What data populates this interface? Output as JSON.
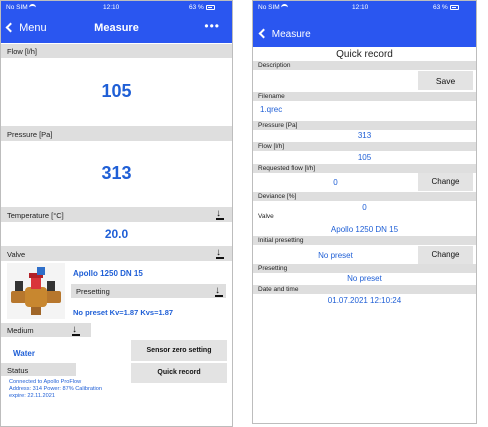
{
  "left": {
    "status": {
      "carrier": "No SIM",
      "time": "12:10",
      "battery": "63 %"
    },
    "nav": {
      "back_label": "Menu",
      "title": "Measure",
      "more": "•••"
    },
    "flow": {
      "label": "Flow [l/h]",
      "value": "105"
    },
    "pressure": {
      "label": "Pressure [Pa]",
      "value": "313"
    },
    "temperature": {
      "label": "Temperature [°C]",
      "value": "20.0"
    },
    "valve": {
      "label": "Valve",
      "name": "Apollo 1250 DN 15",
      "presetting_label": "Presetting",
      "preset_info": "No preset Kv=1.87 Kvs=1.87"
    },
    "medium": {
      "label": "Medium",
      "value": "Water"
    },
    "buttons": {
      "sensor_zero": "Sensor zero setting",
      "quick_record": "Quick record"
    },
    "status_section": {
      "label": "Status",
      "line1": "Connected to Apollo ProFlow",
      "line2": "Address: 314 Power: 87% Calibration",
      "line3": "expire: 22.11.2021"
    }
  },
  "right": {
    "status": {
      "carrier": "No SIM",
      "time": "12:10",
      "battery": "63 %"
    },
    "nav": {
      "back_label": "Measure"
    },
    "title": "Quick record",
    "description": {
      "label": "Description",
      "value": "",
      "save": "Save"
    },
    "filename": {
      "label": "Filename",
      "value": "1.qrec"
    },
    "pressure": {
      "label": "Pressure [Pa]",
      "value": "313"
    },
    "flow": {
      "label": "Flow [l/h]",
      "value": "105"
    },
    "requested_flow": {
      "label": "Requested flow [l/h]",
      "value": "0",
      "change": "Change"
    },
    "deviance": {
      "label": "Deviance [%]",
      "value": "0"
    },
    "valve": {
      "label": "Valve",
      "value": "Apollo 1250 DN 15"
    },
    "initial_presetting": {
      "label": "Initial presetting",
      "value": "No preset",
      "change": "Change"
    },
    "presetting": {
      "label": "Presetting",
      "value": "No preset"
    },
    "datetime": {
      "label": "Date and time",
      "value": "01.07.2021 12:10:24"
    }
  },
  "colors": {
    "accent": "#2a56f0",
    "value_blue": "#1f5fd6",
    "section_grey": "#dedede"
  },
  "icons": [
    "back-chevron-icon",
    "more-icon",
    "download-icon",
    "wifi-icon",
    "battery-icon"
  ]
}
